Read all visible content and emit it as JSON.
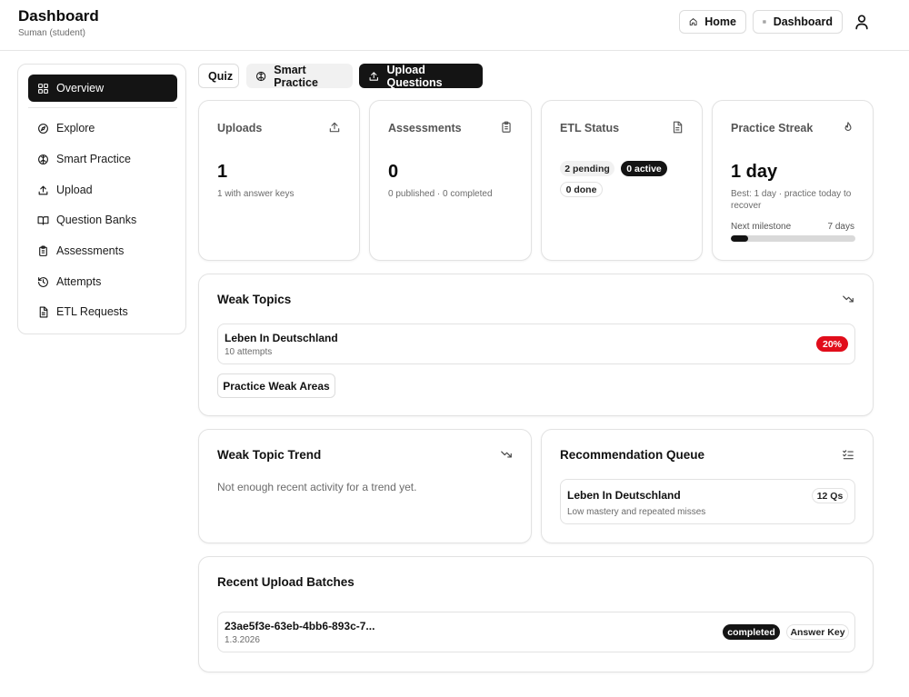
{
  "header": {
    "title": "Dashboard",
    "subtitle": "Suman (student)",
    "home_label": "Home",
    "dashboard_label": "Dashboard"
  },
  "sidebar": {
    "items": [
      {
        "label": "Overview",
        "icon": "grid-icon",
        "active": true
      },
      {
        "label": "Explore",
        "icon": "compass-icon"
      },
      {
        "label": "Smart Practice",
        "icon": "brain-icon"
      },
      {
        "label": "Upload",
        "icon": "upload-icon"
      },
      {
        "label": "Question Banks",
        "icon": "book-open-icon"
      },
      {
        "label": "Assessments",
        "icon": "clipboard-icon"
      },
      {
        "label": "Attempts",
        "icon": "history-icon"
      },
      {
        "label": "ETL Requests",
        "icon": "file-text-icon"
      }
    ]
  },
  "tabs": {
    "quiz": "Quiz",
    "smart_practice": "Smart Practice",
    "upload_questions": "Upload Questions"
  },
  "stats": {
    "uploads": {
      "title": "Uploads",
      "value": "1",
      "sub": "1 with answer keys"
    },
    "assessments": {
      "title": "Assessments",
      "value": "0",
      "sub": "0 published · 0 completed"
    },
    "etl": {
      "title": "ETL Status",
      "pending": "2 pending",
      "active": "0 active",
      "done": "0 done"
    },
    "streak": {
      "title": "Practice Streak",
      "value": "1 day",
      "sub": "Best: 1 day · practice today to recover",
      "milestone_label": "Next milestone",
      "milestone_days": "7 days",
      "progress_fraction": 0.14
    }
  },
  "weak_topics": {
    "title": "Weak Topics",
    "items": [
      {
        "name": "Leben In Deutschland",
        "attempts": "10 attempts",
        "score": "20%"
      }
    ],
    "practice_button": "Practice Weak Areas"
  },
  "weak_trend": {
    "title": "Weak Topic Trend",
    "empty": "Not enough recent activity for a trend yet."
  },
  "recommendation": {
    "title": "Recommendation Queue",
    "items": [
      {
        "name": "Leben In Deutschland",
        "reason": "Low mastery and repeated misses",
        "count": "12 Qs"
      }
    ]
  },
  "uploads_recent": {
    "title": "Recent Upload Batches",
    "items": [
      {
        "id": "23ae5f3e-63eb-4bb6-893c-7...",
        "date": "1.3.2026",
        "status": "completed",
        "tag": "Answer Key"
      }
    ]
  },
  "colors": {
    "dark": "#141414",
    "danger": "#e10d1b",
    "border": "#e2e2e2"
  }
}
